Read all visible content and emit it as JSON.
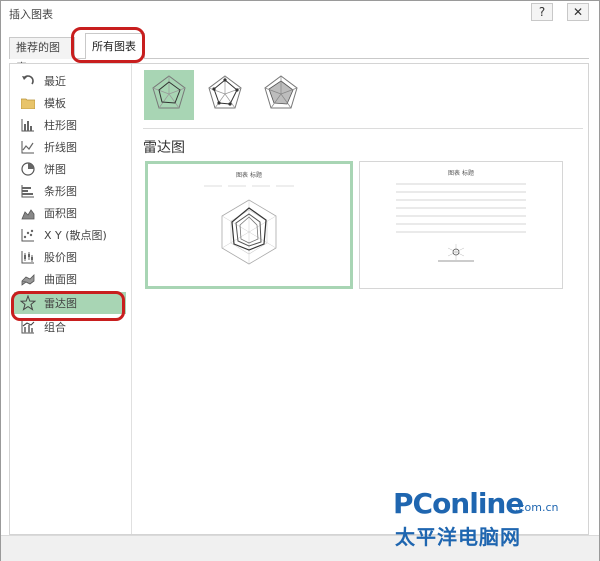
{
  "window": {
    "title": "插入图表",
    "help_glyph": "?",
    "close_glyph": "✕"
  },
  "tabs": [
    {
      "label": "推荐的图表"
    },
    {
      "label": "所有图表"
    }
  ],
  "sidebar": {
    "items": [
      {
        "label": "最近",
        "icon": "recent-icon"
      },
      {
        "label": "模板",
        "icon": "folder-icon"
      },
      {
        "label": "柱形图",
        "icon": "column-chart-icon"
      },
      {
        "label": "折线图",
        "icon": "line-chart-icon"
      },
      {
        "label": "饼图",
        "icon": "pie-chart-icon"
      },
      {
        "label": "条形图",
        "icon": "bar-chart-icon"
      },
      {
        "label": "面积图",
        "icon": "area-chart-icon"
      },
      {
        "label": "X Y (散点图)",
        "icon": "scatter-chart-icon"
      },
      {
        "label": "股价图",
        "icon": "stock-chart-icon"
      },
      {
        "label": "曲面图",
        "icon": "surface-chart-icon"
      },
      {
        "label": "雷达图",
        "icon": "radar-chart-icon",
        "selected": true
      },
      {
        "label": "组合",
        "icon": "combo-chart-icon"
      }
    ]
  },
  "main": {
    "section_title": "雷达图",
    "preview_title": "图表 标题"
  },
  "watermark": {
    "brand": "PConline",
    "domain": ".com.cn",
    "chinese": "太平洋电脑网"
  },
  "colors": {
    "selection": "#a8d5b4",
    "highlight": "#c81e1e",
    "brand": "#1f66b0"
  }
}
